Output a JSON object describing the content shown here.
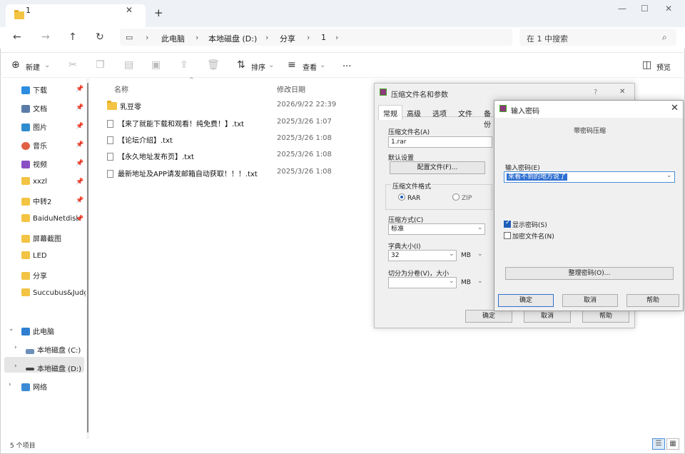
{
  "explorer": {
    "tab_title": "1",
    "breadcrumbs": [
      "此电脑",
      "本地磁盘 (D:)",
      "分享",
      "1"
    ],
    "search_placeholder": "在 1 中搜索",
    "toolbar": {
      "new_label": "新建",
      "sort_label": "排序",
      "view_label": "查看",
      "more_label": "...",
      "preview_label": "预览"
    },
    "sidebar": {
      "quick": [
        {
          "label": "下载",
          "icon": "download-icon",
          "color": "#2d8de0"
        },
        {
          "label": "文档",
          "icon": "document-icon",
          "color": "#5b7ca8"
        },
        {
          "label": "图片",
          "icon": "picture-icon",
          "color": "#2f8ccf"
        },
        {
          "label": "音乐",
          "icon": "music-icon",
          "color": "#e06044"
        },
        {
          "label": "视频",
          "icon": "video-icon",
          "color": "#8a4fc4"
        },
        {
          "label": "xxzl",
          "icon": "folder-icon",
          "color": "#f3c343"
        },
        {
          "label": "中转2",
          "icon": "folder-icon",
          "color": "#f3c343"
        },
        {
          "label": "BaiduNetdisk",
          "icon": "folder-icon",
          "color": "#f3c343"
        },
        {
          "label": "屏幕截图",
          "icon": "folder-icon",
          "color": "#f3c343"
        },
        {
          "label": "LED",
          "icon": "folder-icon",
          "color": "#f3c343"
        },
        {
          "label": "分享",
          "icon": "folder-icon",
          "color": "#f3c343"
        },
        {
          "label": "Succubus&Judgm",
          "icon": "folder-icon",
          "color": "#f3c343"
        }
      ],
      "this_pc": "此电脑",
      "drive_c": "本地磁盘 (C:)",
      "drive_d": "本地磁盘 (D:)",
      "network": "网络"
    },
    "columns": {
      "name": "名称",
      "date": "修改日期"
    },
    "files": [
      {
        "name": "乳豆零",
        "date": "2026/9/22 22:39",
        "type": "folder"
      },
      {
        "name": "【来了就能下载和观看！纯免费！】.txt",
        "date": "2025/3/26 1:07",
        "type": "txt"
      },
      {
        "name": "【论坛介绍】.txt",
        "date": "2025/3/26 1:08",
        "type": "txt"
      },
      {
        "name": "【永久地址发布页】.txt",
        "date": "2025/3/26 1:08",
        "type": "txt"
      },
      {
        "name": "最新地址及APP请发邮箱自动获取！！！.txt",
        "date": "2025/3/26 1:08",
        "type": "txt"
      }
    ],
    "status": "5 个项目"
  },
  "archive_dialog": {
    "title": "压缩文件名和参数",
    "help": "?",
    "tabs": [
      "常规",
      "高级",
      "选项",
      "文件",
      "备份"
    ],
    "archive_name_label": "压缩文件名(A)",
    "archive_name_value": "1.rar",
    "default_settings_label": "默认设置",
    "profiles_button": "配置文件(F)...",
    "format_label": "压缩文件格式",
    "format_rar": "RAR",
    "format_zip": "ZIP",
    "method_label": "压缩方式(C)",
    "method_value": "标准",
    "dict_label": "字典大小(I)",
    "dict_value": "32",
    "dict_unit": "MB",
    "split_label": "切分为分卷(V)，大小",
    "split_unit": "MB",
    "ok_button": "确定",
    "cancel_button": "取消",
    "help_button": "帮助"
  },
  "password_dialog": {
    "title": "输入密码",
    "subtitle": "带密码压缩",
    "password_label": "输入密码(E)",
    "password_value": "来看不到的地方说了",
    "show_password_label": "显示密码(S)",
    "show_password_checked": true,
    "encrypt_names_label": "加密文件名(N)",
    "encrypt_names_checked": false,
    "organize_button": "整理密码(O)...",
    "ok_button": "确定",
    "cancel_button": "取消",
    "help_button": "帮助"
  }
}
